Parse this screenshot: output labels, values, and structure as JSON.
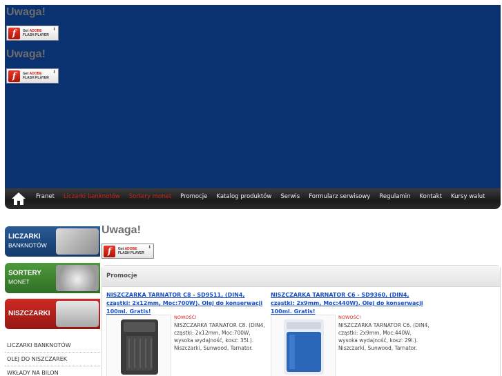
{
  "header": {
    "alerts": [
      {
        "title": "Uwaga!",
        "flash_badge": {
          "get": "Get",
          "adobe": "ADOBE",
          "player": "FLASH PLAYER"
        }
      },
      {
        "title": "Uwaga!",
        "flash_badge": {
          "get": "Get",
          "adobe": "ADOBE",
          "player": "FLASH PLAYER"
        }
      }
    ],
    "background": "#0a3271"
  },
  "nav": {
    "items": [
      {
        "label": "Franet",
        "color": "#f0f0f0"
      },
      {
        "label": "Liczarki banknotów",
        "color": "#c8241b"
      },
      {
        "label": "Sortery monet",
        "color": "#c8241b"
      },
      {
        "label": "Promocje",
        "color": "#f0f0f0"
      },
      {
        "label": "Katalog produktów",
        "color": "#f0f0f0"
      },
      {
        "label": "Serwis",
        "color": "#f0f0f0"
      },
      {
        "label": "Formularz serwisowy",
        "color": "#f0f0f0"
      },
      {
        "label": "Regulamin",
        "color": "#f0f0f0"
      },
      {
        "label": "Kontakt",
        "color": "#f0f0f0"
      },
      {
        "label": "Kursy walut",
        "color": "#f0f0f0"
      }
    ]
  },
  "sidebar": {
    "banners": [
      {
        "line1": "Liczarki",
        "line2": "banknotów"
      },
      {
        "line1": "Sortery",
        "line2": "monet"
      },
      {
        "line1": "Niszczarki",
        "line2": ""
      }
    ],
    "menu": [
      "Liczarki banknotów",
      "Olej do niszczarek",
      "Wkłady na bilon"
    ]
  },
  "content_alert": {
    "title": "Uwaga!",
    "flash_badge": {
      "get": "Get",
      "adobe": "ADOBE",
      "player": "FLASH PLAYER"
    }
  },
  "promotions": {
    "heading": "Promocje",
    "items": [
      {
        "title": "NISZCZARKA TARNATOR C8 - SD9511, (DIN4, cząstki: 2x12mm, Moc:700W). Olej do konserwacji 100ml. Gratis!",
        "badge": "NOWOŚĆ!",
        "description": "NISZCZARKA TARNATOR C8. (DIN4, cząstki: 2x12mm, Moc:700W, wysoka wydajność, kosz: 35l.). Niszczarki, Sunwood, Tarnator.",
        "color": "#3a3a3a"
      },
      {
        "title": "NISZCZARKA TARNATOR C6 - SD9360, (DIN4, cząstki: 2x9mm, Moc:440W). Olej do konserwacji 100ml. Gratis!",
        "badge": "NOWOŚĆ!",
        "description": "NISZCZARKA TARNATOR C6. (DIN4, cząstki: 2x9mm, Moc:440W, wysoka wydajność, kosz: 29l.). Niszczarki, Sunwood, Tarnator.",
        "color": "#2b67b8"
      }
    ]
  }
}
